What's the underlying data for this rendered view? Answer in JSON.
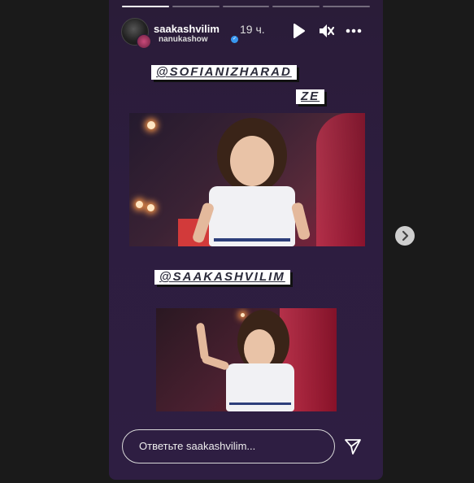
{
  "story": {
    "progress_segments": 5,
    "active_segment": 0,
    "header": {
      "username": "saakashvilim",
      "time": "19 ч.",
      "subuser": "nanukashow",
      "icons": [
        "play-icon",
        "mute-icon",
        "more-icon"
      ]
    },
    "tags": [
      "@SOFIANIZHARAD",
      "ZE",
      "@SAAKASHVILIM"
    ],
    "reply": {
      "placeholder": "Ответьте saakashvilim..."
    },
    "send_icon": "send-icon"
  },
  "nav": {
    "next_icon": "chevron-right-icon"
  },
  "colors": {
    "background": "#1a1a1a",
    "story_bg": "#2d1d3f",
    "tag_bg": "#ffffff",
    "verified": "#3897f0"
  }
}
